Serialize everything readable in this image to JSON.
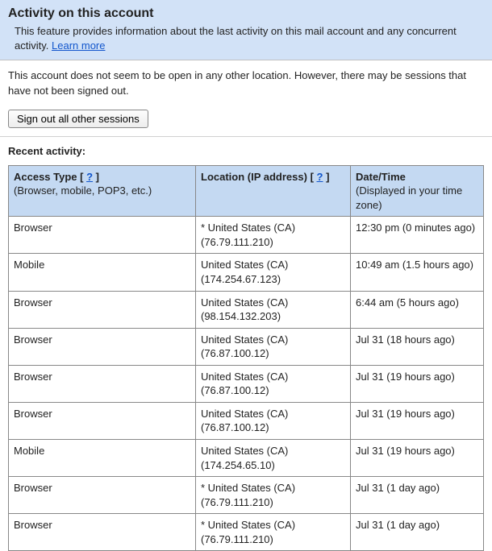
{
  "header": {
    "title": "Activity on this account",
    "desc_prefix": "This feature provides information about the last activity on this mail account and any concurrent activity. ",
    "learn_more": "Learn more"
  },
  "status": {
    "text": "This account does not seem to be open in any other location. However, there may be sessions that have not been signed out.",
    "signout_label": "Sign out all other sessions"
  },
  "recent": {
    "heading": "Recent activity:",
    "headers": {
      "access_type_label": "Access Type",
      "access_type_help": "?",
      "access_type_sub": "(Browser, mobile, POP3, etc.)",
      "location_label": "Location (IP address)",
      "location_help": "?",
      "datetime_label": "Date/Time",
      "datetime_sub": "(Displayed in your time zone)"
    },
    "rows": [
      {
        "access": "Browser",
        "location": "* United States (CA) (76.79.111.210)",
        "datetime": "12:30 pm (0 minutes ago)"
      },
      {
        "access": "Mobile",
        "location": "United States (CA) (174.254.67.123)",
        "datetime": "10:49 am (1.5 hours ago)"
      },
      {
        "access": "Browser",
        "location": "United States (CA) (98.154.132.203)",
        "datetime": "6:44 am (5 hours ago)"
      },
      {
        "access": "Browser",
        "location": "United States (CA) (76.87.100.12)",
        "datetime": "Jul 31 (18 hours ago)"
      },
      {
        "access": "Browser",
        "location": "United States (CA) (76.87.100.12)",
        "datetime": "Jul 31 (19 hours ago)"
      },
      {
        "access": "Browser",
        "location": "United States (CA) (76.87.100.12)",
        "datetime": "Jul 31 (19 hours ago)"
      },
      {
        "access": "Mobile",
        "location": "United States (CA) (174.254.65.10)",
        "datetime": "Jul 31 (19 hours ago)"
      },
      {
        "access": "Browser",
        "location": "* United States (CA) (76.79.111.210)",
        "datetime": "Jul 31 (1 day ago)"
      },
      {
        "access": "Browser",
        "location": "* United States (CA) (76.79.111.210)",
        "datetime": "Jul 31 (1 day ago)"
      }
    ]
  }
}
